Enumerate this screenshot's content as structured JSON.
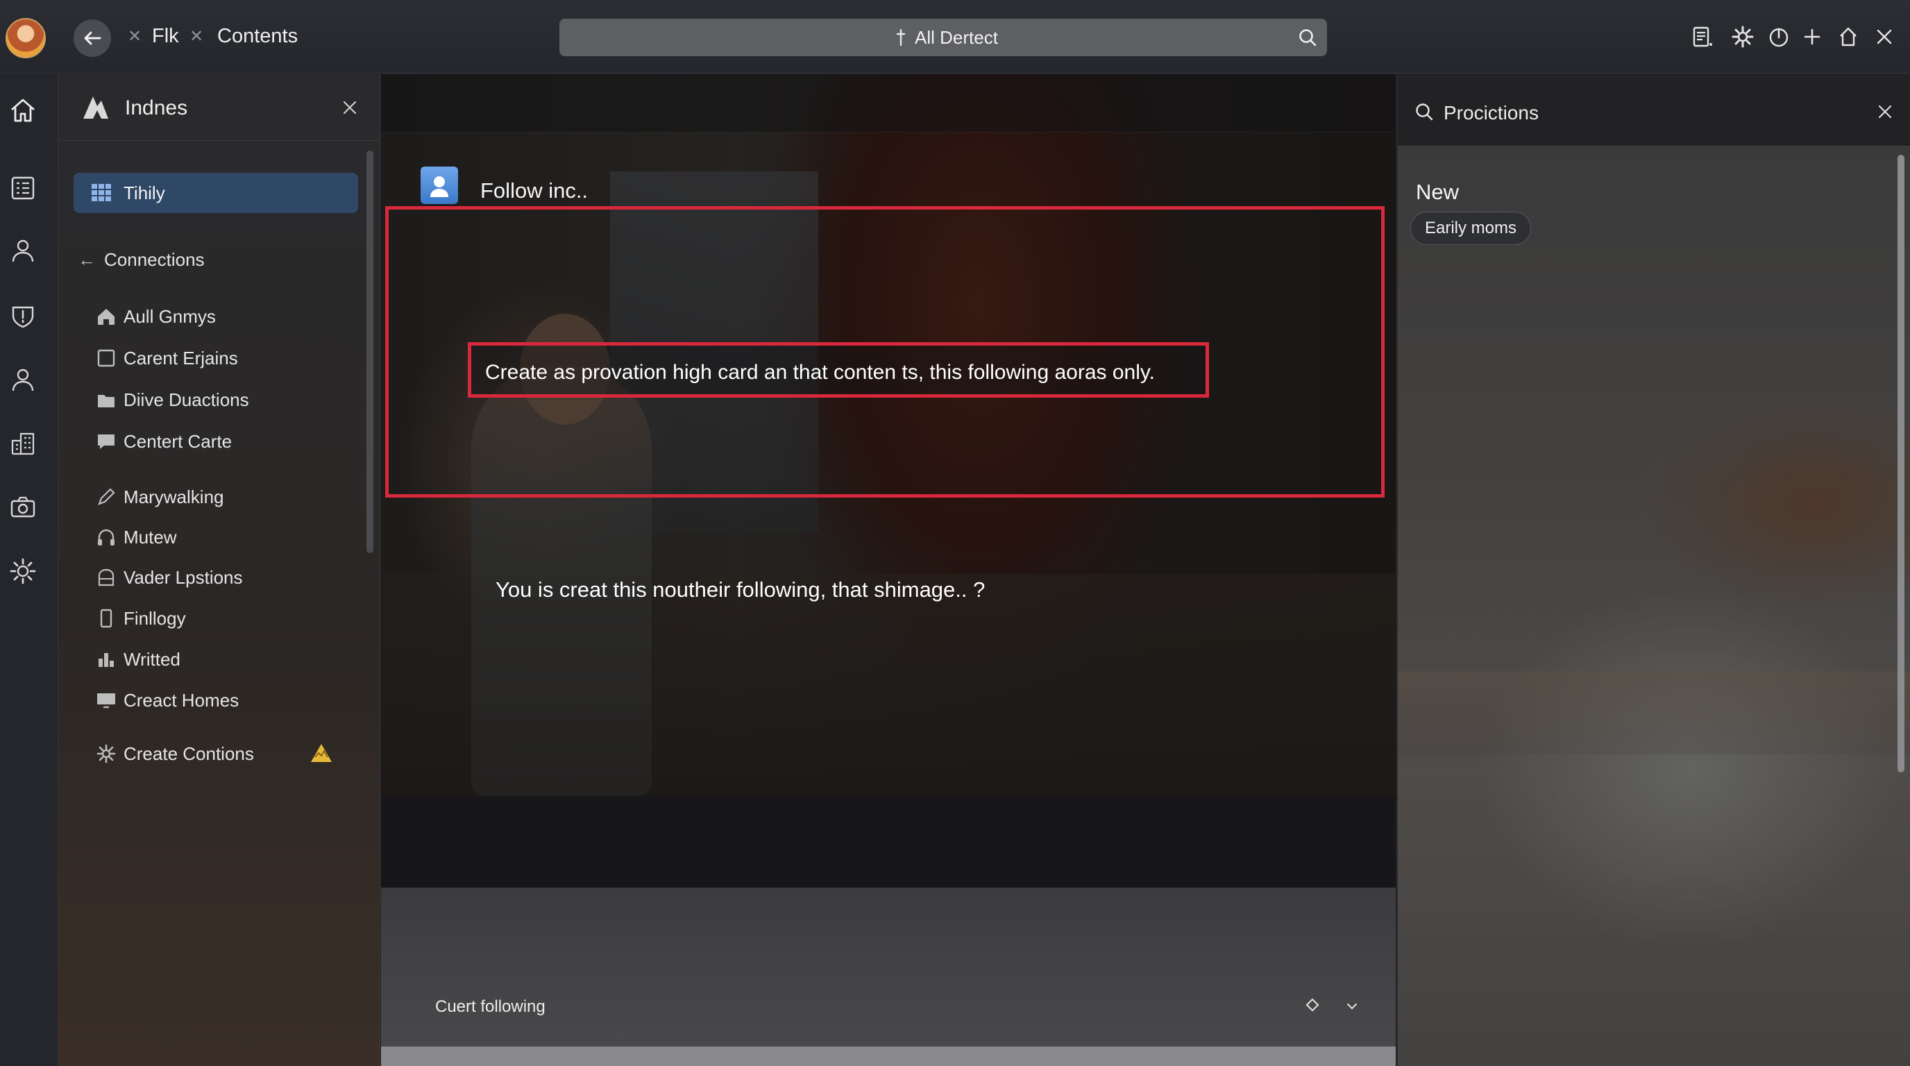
{
  "topbar": {
    "breadcrumb": [
      "Flk",
      "Contents"
    ],
    "search_value": "All Dertect"
  },
  "nav": {
    "title": "Indnes",
    "active_item": "Tihily",
    "section_label": "Connections",
    "items": [
      {
        "label": "Aull Gnmys",
        "icon": "home-icon"
      },
      {
        "label": "Carent Erjains",
        "icon": "square-icon"
      },
      {
        "label": "Diive Duactions",
        "icon": "folder-icon"
      },
      {
        "label": "Centert Carte",
        "icon": "chat-icon"
      },
      {
        "label": "Marywalking",
        "icon": "pen-icon"
      },
      {
        "label": "Mutew",
        "icon": "headphones-icon"
      },
      {
        "label": "Vader Lpstions",
        "icon": "archive-icon"
      },
      {
        "label": "Finllogy",
        "icon": "phone-icon"
      },
      {
        "label": "Writted",
        "icon": "bar-chart-icon"
      },
      {
        "label": "Creact Homes",
        "icon": "monitor-icon"
      },
      {
        "label": "Create Contions",
        "icon": "gear-icon"
      }
    ]
  },
  "main": {
    "message_title": "Follow inc..",
    "highlight_text": "Create as provation high card an that conten ts, this following aoras only.",
    "question_text": "You is creat this noutheir following, that shimage.. ?",
    "footer_label": "Cuert following"
  },
  "right_panel": {
    "title": "Procictions",
    "section_title": "New",
    "chip_label": "Earily moms"
  },
  "colors": {
    "highlight_border": "#d8283c",
    "active_item_bg": "#2f4868",
    "warning_badge": "#e6b83a"
  }
}
